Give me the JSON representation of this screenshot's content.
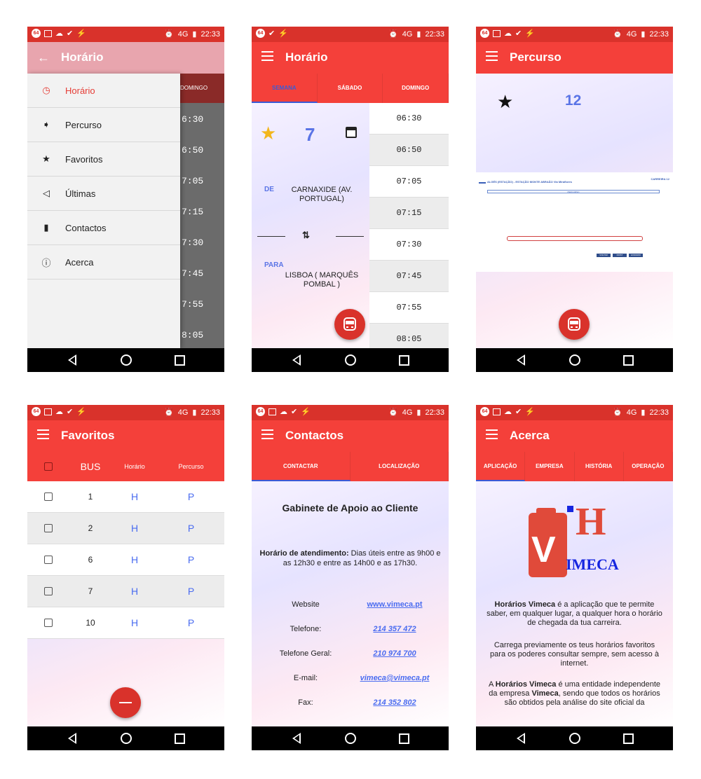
{
  "status": {
    "time": "22:33",
    "net": "4G",
    "badge": "64"
  },
  "screen1": {
    "title": "Horário",
    "back_tab": "DOMINGO",
    "bg_times": [
      "6:30",
      "6:50",
      "7:05",
      "7:15",
      "7:30",
      "7:45",
      "7:55",
      "8:05"
    ],
    "menu": [
      {
        "label": "Horário",
        "icon": "clock-icon",
        "active": true
      },
      {
        "label": "Percurso",
        "icon": "signpost-icon"
      },
      {
        "label": "Favoritos",
        "icon": "star-icon"
      },
      {
        "label": "Últimas",
        "icon": "megaphone-icon"
      },
      {
        "label": "Contactos",
        "icon": "contacts-book-icon"
      },
      {
        "label": "Acerca",
        "icon": "info-icon"
      }
    ]
  },
  "screen2": {
    "title": "Horário",
    "tabs": [
      "SEMANA",
      "SÁBADO",
      "DOMINGO"
    ],
    "bus_number": "7",
    "from_label": "DE",
    "from_place": "CARNAXIDE (AV. PORTUGAL)",
    "to_label": "PARA",
    "to_place": "LISBOA ( MARQUÊS POMBAL )",
    "swap_symbol": "⇅",
    "times": [
      "06:30",
      "06:50",
      "07:05",
      "07:15",
      "07:30",
      "07:45",
      "07:55",
      "08:05"
    ]
  },
  "screen3": {
    "title": "Percurso",
    "bus_number": "12",
    "route_title": "ALGÉS (ESTAÇÃO) - ESTAÇÃO MONTE ABRAÃO Via Miraflores",
    "carreira": "CARREIRA 12",
    "route_bar": "PERCURSO",
    "buttons": [
      "VOLTAR",
      "FIRST",
      "HORARIO"
    ]
  },
  "screen4": {
    "title": "Favoritos",
    "header": {
      "bus": "BUS",
      "horario": "Horário",
      "percurso": "Percurso"
    },
    "rows": [
      {
        "bus": "1",
        "h": "H",
        "p": "P"
      },
      {
        "bus": "2",
        "h": "H",
        "p": "P"
      },
      {
        "bus": "6",
        "h": "H",
        "p": "P"
      },
      {
        "bus": "7",
        "h": "H",
        "p": "P"
      },
      {
        "bus": "10",
        "h": "H",
        "p": "P"
      }
    ]
  },
  "screen5": {
    "title": "Contactos",
    "tabs": [
      "CONTACTAR",
      "LOCALIZAÇÃO"
    ],
    "heading": "Gabinete de Apoio ao Cliente",
    "hours_label": "Horário de atendimento:",
    "hours_text": " Dias úteis entre as 9h00 e as 12h30 e entre as 14h00 e as 17h30.",
    "contacts": [
      {
        "label": "Website",
        "value": "www.vimeca.pt"
      },
      {
        "label": "Telefone:",
        "value": "214 357 472"
      },
      {
        "label": "Telefone Geral:",
        "value": "210 974 700"
      },
      {
        "label": "E-mail:",
        "value": "vimeca@vimeca.pt"
      },
      {
        "label": "Fax:",
        "value": "214 352 802"
      }
    ]
  },
  "screen6": {
    "title": "Acerca",
    "tabs": [
      "APLICAÇÃO",
      "EMPRESA",
      "HISTÓRIA",
      "OPERAÇÃO"
    ],
    "logo_h": "H",
    "logo_v": "V",
    "logo_imeca": "IMECA",
    "p1_bold": "Horários Vimeca",
    "p1": " é a aplicação que te permite saber, em qualquer lugar, a qualquer hora o horário de chegada da tua carreira.",
    "p2": "Carrega previamente os teus horários favoritos para os poderes consultar sempre, sem acesso à internet.",
    "p3_a": "A ",
    "p3_bold": "Horários Vimeca",
    "p3_b": " é uma entidade independente da empresa ",
    "p3_bold2": "Vimeca",
    "p3_c": ", sendo que todos os horários são obtidos pela análise do site oficial da"
  }
}
